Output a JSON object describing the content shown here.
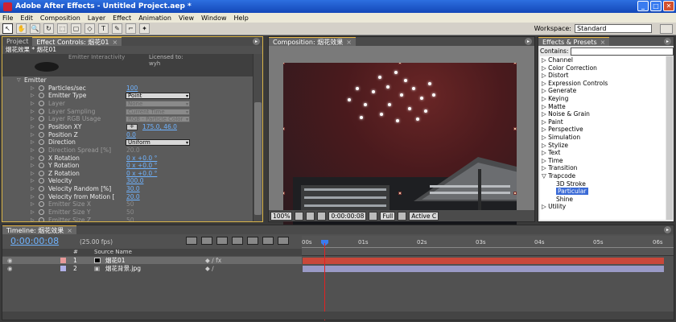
{
  "window": {
    "title": "Adobe After Effects - Untitled Project.aep *",
    "min": "_",
    "max": "□",
    "close": "✕"
  },
  "menu": [
    "File",
    "Edit",
    "Composition",
    "Layer",
    "Effect",
    "Animation",
    "View",
    "Window",
    "Help"
  ],
  "toolbar": {
    "tools": [
      "↖",
      "✋",
      "🔍",
      "↻",
      "⬚",
      "▢",
      "◇",
      "T",
      "✎",
      "⌐",
      "✦"
    ],
    "workspace_label": "Workspace:",
    "workspace_value": "Standard"
  },
  "effect_controls": {
    "tabs": [
      "Project",
      "Effect Controls: 烟花01"
    ],
    "header": "烟花效果 * 烟花01",
    "plugin_text": "Emitter Interactivity",
    "license_text": "Licensed to:",
    "license_name": "wyh",
    "rows": [
      {
        "label": "Emitter",
        "type": "group"
      },
      {
        "label": "Particles/sec",
        "value": "100"
      },
      {
        "label": "Emitter Type",
        "dropdown": "Point"
      },
      {
        "label": "Layer",
        "dropdown": "None",
        "dim": true
      },
      {
        "label": "Layer Sampling",
        "dropdown": "Current Time",
        "dim": true
      },
      {
        "label": "Layer RGB Usage",
        "dropdown": "RGB - Particle Color",
        "dim": true
      },
      {
        "label": "Position XY",
        "value": "175.0, 46.0",
        "xy": true
      },
      {
        "label": "Position Z",
        "value": "0.0"
      },
      {
        "label": "Direction",
        "dropdown": "Uniform"
      },
      {
        "label": "Direction Spread [%]",
        "value": "20.0",
        "dim": true
      },
      {
        "label": "X Rotation",
        "value": "0 x +0.0 °"
      },
      {
        "label": "Y Rotation",
        "value": "0 x +0.0 °"
      },
      {
        "label": "Z Rotation",
        "value": "0 x +0.0 °"
      },
      {
        "label": "Velocity",
        "value": "300.0"
      },
      {
        "label": "Velocity Random [%]",
        "value": "30.0"
      },
      {
        "label": "Velocity from Motion [",
        "value": "20.0"
      },
      {
        "label": "Emitter Size X",
        "value": "50",
        "dim": true
      },
      {
        "label": "Emitter Size Y",
        "value": "50",
        "dim": true
      },
      {
        "label": "Emitter Size Z",
        "value": "50",
        "dim": true
      }
    ]
  },
  "composition": {
    "tab": "Composition: 烟花效果",
    "zoom": "100%",
    "timecode": "0:00:00:08",
    "resolution": "Full",
    "camera": "Active C"
  },
  "effects_presets": {
    "tab": "Effects & Presets",
    "contains_label": "Contains:",
    "items": [
      {
        "label": "▷ Channel"
      },
      {
        "label": "▷ Color Correction"
      },
      {
        "label": "▷ Distort"
      },
      {
        "label": "▷ Expression Controls"
      },
      {
        "label": "▷ Generate"
      },
      {
        "label": "▷ Keying"
      },
      {
        "label": "▷ Matte"
      },
      {
        "label": "▷ Noise & Grain"
      },
      {
        "label": "▷ Paint"
      },
      {
        "label": "▷ Perspective"
      },
      {
        "label": "▷ Simulation"
      },
      {
        "label": "▷ Stylize"
      },
      {
        "label": "▷ Text"
      },
      {
        "label": "▷ Time"
      },
      {
        "label": "▷ Transition"
      },
      {
        "label": "▽ Trapcode"
      },
      {
        "label": "3D Stroke",
        "child": true
      },
      {
        "label": "Particular",
        "child": true,
        "selected": true
      },
      {
        "label": "Shine",
        "child": true
      },
      {
        "label": "▷ Utility"
      }
    ]
  },
  "timeline": {
    "tab": "Timeline: 烟花效果",
    "time": "0:00:00:08",
    "fps": "(25.00 fps)",
    "col_hash": "#",
    "col_source": "Source Name",
    "layers": [
      {
        "num": "1",
        "name": "烟花01",
        "color": "#e89a9a"
      },
      {
        "num": "2",
        "name": "烟花背景.jpg",
        "color": "#b0b0e8"
      }
    ],
    "ruler": [
      "00s",
      "01s",
      "02s",
      "03s",
      "04s",
      "05s",
      "06s"
    ],
    "colors": {
      "layer1_bar": "#c9483a",
      "layer2_bar": "#9a9ac6",
      "playhead": "#e22222"
    }
  }
}
